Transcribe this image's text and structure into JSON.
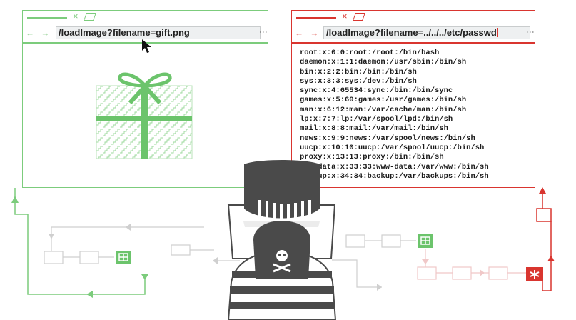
{
  "left_browser": {
    "tab_close": "×",
    "nav_icons": "← →",
    "reload": "C",
    "url": "/loadImage?filename=gift.png",
    "menu_dots": "⋮"
  },
  "right_browser": {
    "tab_close": "×",
    "nav_icons": "← →",
    "reload": "C",
    "url": "/loadImage?filename=../../../etc/passwd",
    "menu_dots": "⋮",
    "passwd_lines": [
      "root:x:0:0:root:/root:/bin/bash",
      "daemon:x:1:1:daemon:/usr/sbin:/bin/sh",
      "bin:x:2:2:bin:/bin:/bin/sh",
      "sys:x:3:3:sys:/dev:/bin/sh",
      "sync:x:4:65534:sync:/bin:/bin/sync",
      "games:x:5:60:games:/usr/games:/bin/sh",
      "man:x:6:12:man:/var/cache/man:/bin/sh",
      "lp:x:7:7:lp:/var/spool/lpd:/bin/sh",
      "mail:x:8:8:mail:/var/mail:/bin/sh",
      "news:x:9:9:news:/var/spool/news:/bin/sh",
      "uucp:x:10:10:uucp:/var/spool/uucp:/bin/sh",
      "proxy:x:13:13:proxy:/bin:/bin/sh",
      "www-data:x:33:33:www-data:/var/www:/bin/sh",
      "backup:x:34:34:backup:/var/backups:/bin/sh"
    ]
  },
  "colors": {
    "safe_green": "#7ccc7c",
    "gift_green": "#6cc46c",
    "danger_red": "#d9352f",
    "hacker_gray": "#4a4a4a",
    "flow_gray": "#cfcfcf",
    "flow_pink": "#f0c8c8"
  },
  "icons": [
    "gift-icon",
    "mouse-pointer-icon",
    "skull-crossbones-icon",
    "asterisk-file-icon",
    "image-file-icon",
    "folder-icon"
  ]
}
